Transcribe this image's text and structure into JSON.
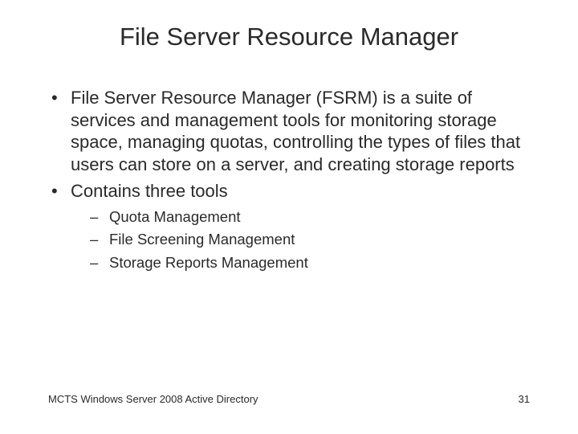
{
  "slide": {
    "title": "File Server Resource Manager",
    "bullets": [
      {
        "text": "File Server Resource Manager (FSRM) is a suite of services and management tools for monitoring storage space, managing quotas, controlling the types of files that users can store on a server, and creating storage reports"
      },
      {
        "text": "Contains three tools",
        "children": [
          "Quota Management",
          "File Screening Management",
          "Storage Reports Management"
        ]
      }
    ],
    "footer_left": "MCTS Windows Server 2008 Active Directory",
    "footer_right": "31"
  }
}
